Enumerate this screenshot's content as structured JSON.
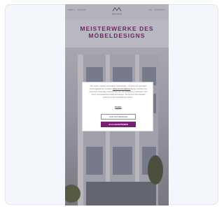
{
  "header": {
    "left_text": "MENU · SUCHE",
    "logo_text": "HÜLSTA",
    "right_text": "DE · KONTAKT"
  },
  "hero": {
    "headline": "MEISTERWERKE DES\nMÖBELDESIGNS"
  },
  "cookie_banner": {
    "text_before_link": "Wir nutzen Cookies und andere Technologien, um Ihnen ein optimales Nutzungserlebnis zu bieten. ",
    "link_text": "Datenschutzerklärung",
    "text_after_link": " Einige Cookies sind technisch notwendig, andere helfen uns, die Website zu verbessern und Ihnen personalisierte Inhalte anzuzeigen. Sie können Ihre Auswahl jederzeit in den Einstellungen ändern.",
    "settings_link": "Details",
    "decline_label": "NUR NOTWENDIGE",
    "accept_label": "ALLE AKZEPTIEREN"
  },
  "colors": {
    "brand": "#7b1f74"
  }
}
